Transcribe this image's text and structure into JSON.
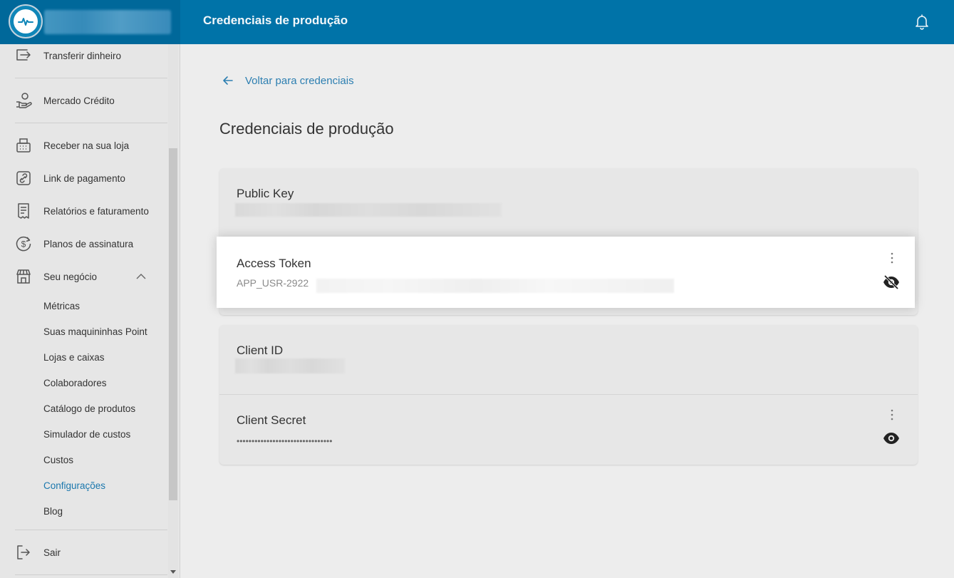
{
  "topbar": {
    "title": "Credenciais de produção"
  },
  "icons": {
    "logo": "pulse-logo-icon",
    "bell": "bell-icon"
  },
  "sidebar": {
    "items": [
      {
        "label": "Transferir dinheiro",
        "icon": "transfer-icon"
      },
      {
        "label": "Mercado Crédito",
        "icon": "hand-coin-icon"
      },
      {
        "label": "Receber na sua loja",
        "icon": "register-icon"
      },
      {
        "label": "Link de pagamento",
        "icon": "link-icon"
      },
      {
        "label": "Relatórios e faturamento",
        "icon": "receipt-icon"
      },
      {
        "label": "Planos de assinatura",
        "icon": "dollar-cycle-icon"
      },
      {
        "label": "Seu negócio",
        "icon": "store-icon",
        "expanded": true
      }
    ],
    "subitems": [
      {
        "label": "Métricas"
      },
      {
        "label": "Suas maquininhas Point"
      },
      {
        "label": "Lojas e caixas"
      },
      {
        "label": "Colaboradores"
      },
      {
        "label": "Catálogo de produtos"
      },
      {
        "label": "Simulador de custos"
      },
      {
        "label": "Custos"
      },
      {
        "label": "Configurações",
        "active": true
      },
      {
        "label": "Blog"
      }
    ],
    "logout": {
      "label": "Sair",
      "icon": "logout-icon"
    }
  },
  "main": {
    "back_label": "Voltar para credenciais",
    "title": "Credenciais de produção",
    "credentials": {
      "public_key": {
        "label": "Public Key"
      },
      "access_token": {
        "label": "Access Token",
        "value": "APP_USR-2922",
        "visibility": "hidden"
      },
      "client_id": {
        "label": "Client ID"
      },
      "client_secret": {
        "label": "Client Secret",
        "value": "••••••••••••••••••••••••••••••••",
        "visibility": "visible"
      }
    }
  },
  "colors": {
    "topbar": "#0073a8",
    "brand_bg": "#00689a",
    "link": "#2d7fb1",
    "active_nav": "#1a77ad"
  }
}
